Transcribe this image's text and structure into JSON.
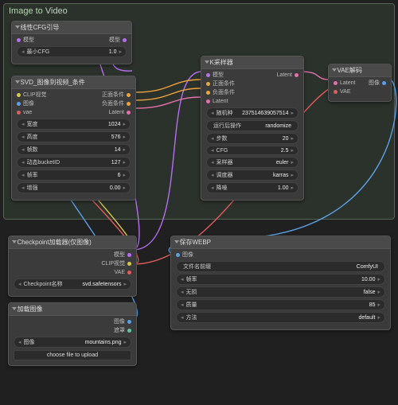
{
  "group": {
    "title": "Image to Video"
  },
  "nodes": {
    "cfg": {
      "title": "线性CFG引导",
      "in_model": "模型",
      "out_model": "模型",
      "w_min_cfg": {
        "label": "最小CFG",
        "value": "1.0"
      }
    },
    "svd": {
      "title": "SVD_图像到视频_条件",
      "in_clip": "CLIP视觉",
      "in_image": "图像",
      "in_vae": "vae",
      "out_pos": "正面条件",
      "out_neg": "负面条件",
      "out_lat": "Latent",
      "w_width": {
        "label": "宽度",
        "value": "1024"
      },
      "w_height": {
        "label": "高度",
        "value": "576"
      },
      "w_frames": {
        "label": "帧数",
        "value": "14"
      },
      "w_bucket": {
        "label": "动态bucketID",
        "value": "127"
      },
      "w_fps": {
        "label": "帧率",
        "value": "6"
      },
      "w_aug": {
        "label": "增强",
        "value": "0.00"
      }
    },
    "ksampler": {
      "title": "K采样器",
      "in_model": "模型",
      "in_pos": "正面条件",
      "in_neg": "负面条件",
      "in_lat": "Latent",
      "out_lat": "Latent",
      "w_seed": {
        "label": "随机种",
        "value": "237514639057514"
      },
      "w_after": {
        "label": "运行后操作",
        "value": "randomize"
      },
      "w_steps": {
        "label": "步数",
        "value": "20"
      },
      "w_cfg": {
        "label": "CFG",
        "value": "2.5"
      },
      "w_sampler": {
        "label": "采样器",
        "value": "euler"
      },
      "w_sched": {
        "label": "调度器",
        "value": "karras"
      },
      "w_denoise": {
        "label": "降噪",
        "value": "1.00"
      }
    },
    "vae": {
      "title": "VAE解码",
      "in_lat": "Latent",
      "in_vae": "VAE",
      "out_img": "图像"
    },
    "ckpt": {
      "title": "Checkpoint加载器(仅图像)",
      "out_model": "模型",
      "out_clip": "CLIP视觉",
      "out_vae": "VAE",
      "w_name": {
        "label": "Checkpoint名称",
        "value": "svd.safetensors"
      }
    },
    "loadimg": {
      "title": "加载图像",
      "out_img": "图像",
      "out_mask": "遮罩",
      "w_image": {
        "label": "图像",
        "value": "mountains.png"
      },
      "btn_upload": "choose file to upload"
    },
    "savewebp": {
      "title": "保存WEBP",
      "in_img": "图像",
      "w_prefix": {
        "label": "文件名前缀",
        "value": "ComfyUI"
      },
      "w_fps": {
        "label": "帧率",
        "value": "10.00"
      },
      "w_lossless": {
        "label": "无损",
        "value": "false"
      },
      "w_quality": {
        "label": "质量",
        "value": "85"
      },
      "w_method": {
        "label": "方法",
        "value": "default"
      }
    }
  }
}
